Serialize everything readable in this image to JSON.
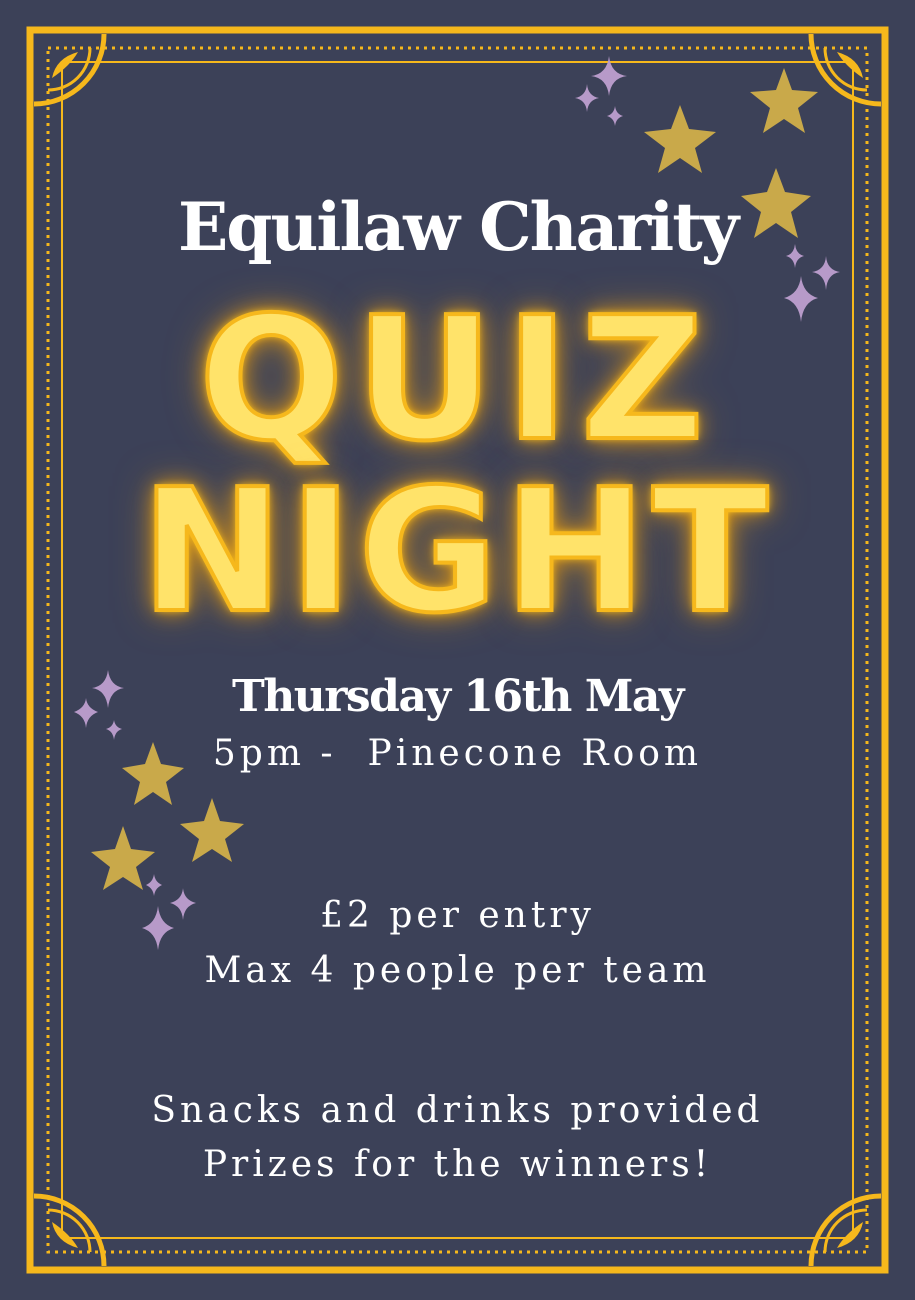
{
  "poster": {
    "organiser": "Equilaw Charity",
    "title_line1": "QUIZ",
    "title_line2": "NIGHT",
    "date": "Thursday 16th May",
    "time_place": "5pm -  Pinecone Room",
    "entry_fee": "£2 per entry",
    "team_size": "Max 4 people per team",
    "refreshments": "Snacks and drinks provided",
    "prizes": "Prizes for the winners!"
  },
  "colors": {
    "background": "#3c4158",
    "frame_gold": "#f6b81c",
    "star_gold": "#c9a94a",
    "sparkle_lilac": "#b79ac9",
    "text": "#ffffff",
    "neon_yellow": "#ffe36a"
  },
  "icons": [
    "gold-star-icon",
    "sparkle-icon",
    "corner-ornament-icon"
  ]
}
